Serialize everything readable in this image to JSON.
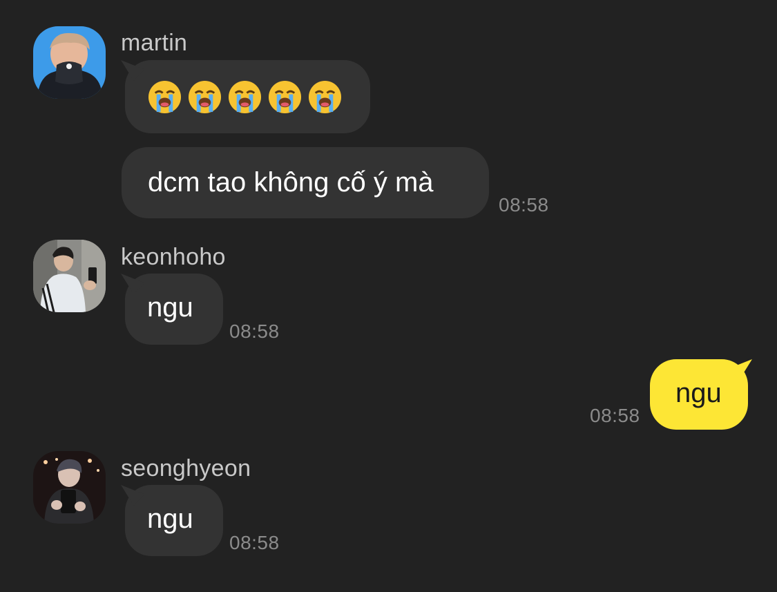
{
  "messages": [
    {
      "sender": "martin",
      "avatar_icon": "avatar-martin",
      "bubbles": [
        {
          "type": "emoji",
          "emoji_name": "loudly-crying-face",
          "count": 5
        },
        {
          "type": "text",
          "text": "dcm tao không cố ý mà",
          "time": "08:58"
        }
      ]
    },
    {
      "sender": "keonhoho",
      "avatar_icon": "avatar-keonhoho",
      "bubbles": [
        {
          "type": "text",
          "text": "ngu",
          "time": "08:58"
        }
      ]
    },
    {
      "sender": "me",
      "bubbles": [
        {
          "type": "text",
          "text": "ngu",
          "time": "08:58"
        }
      ]
    },
    {
      "sender": "seonghyeon",
      "avatar_icon": "avatar-seonghyeon",
      "bubbles": [
        {
          "type": "text",
          "text": "ngu",
          "time": "08:58"
        }
      ]
    }
  ],
  "colors": {
    "background": "#222222",
    "incoming_bubble": "#333333",
    "outgoing_bubble": "#fde635",
    "sender_name": "#c9c9c9",
    "timestamp": "#8b8b8b"
  }
}
